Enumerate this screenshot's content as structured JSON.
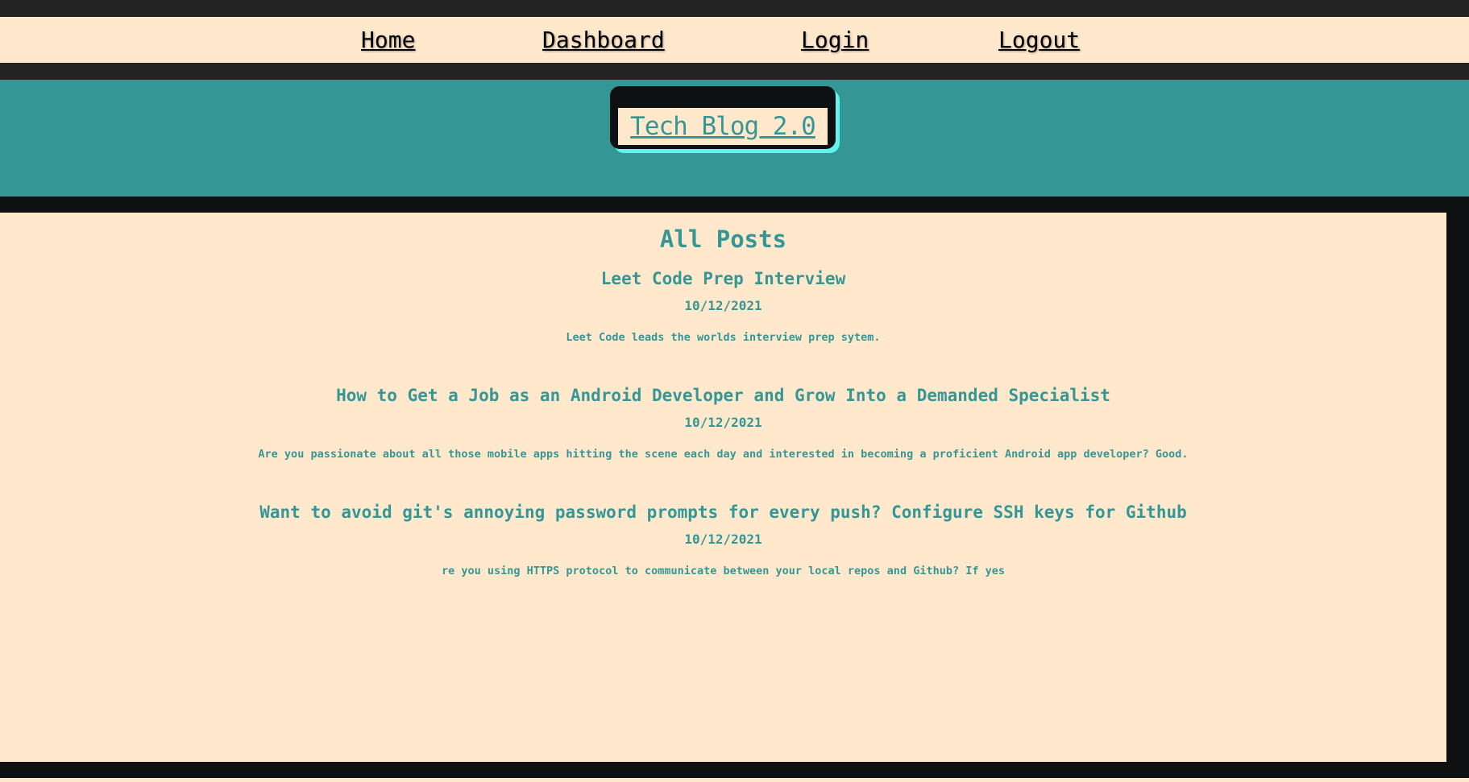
{
  "nav": {
    "home": "Home",
    "dashboard": "Dashboard",
    "login": "Login",
    "logout": "Logout"
  },
  "header": {
    "site_title": "Tech Blog 2.0"
  },
  "main": {
    "heading": "All Posts",
    "posts": [
      {
        "title": "Leet Code Prep Interview",
        "date": "10/12/2021",
        "body": "Leet Code leads the worlds interview prep sytem."
      },
      {
        "title": "How to Get a Job as an Android Developer and Grow Into a Demanded Specialist",
        "date": "10/12/2021",
        "body": "Are you passionate about all those mobile apps hitting the scene each day and interested in becoming a proficient Android app developer? Good."
      },
      {
        "title": "Want to avoid git's annoying password prompts for every push? Configure SSH keys for Github",
        "date": "10/12/2021",
        "body": "re you using HTTPS protocol to communicate between your local repos and Github? If yes"
      }
    ]
  },
  "colors": {
    "cream": "#ffe8cc",
    "teal": "#349795",
    "dark": "#0e1012",
    "charcoal": "#232323",
    "aqua_glow": "#5ff5ee"
  }
}
